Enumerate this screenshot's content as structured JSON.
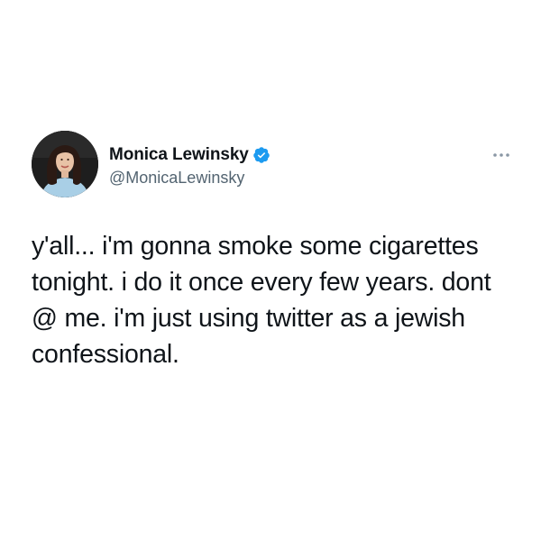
{
  "tweet": {
    "author": {
      "display_name": "Monica Lewinsky",
      "handle": "@MonicaLewinsky",
      "verified": true,
      "verified_color": "#1d9bf0"
    },
    "text": "y'all... i'm gonna smoke some cigarettes tonight. i do it once every few years. dont @ me. i'm just using twitter as a jewish confessional.",
    "icons": {
      "menu": "more-horizontal-icon",
      "badge": "verified-badge-icon"
    }
  }
}
